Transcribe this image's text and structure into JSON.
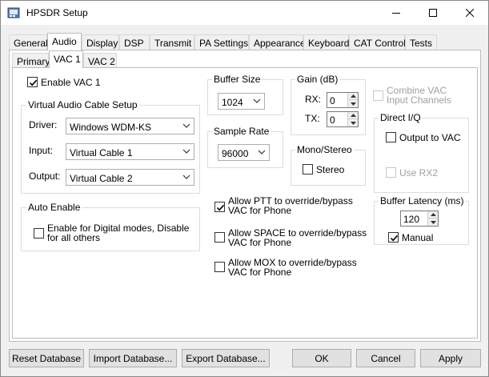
{
  "window": {
    "title": "HPSDR Setup"
  },
  "tabs": [
    {
      "label": "General"
    },
    {
      "label": "Audio"
    },
    {
      "label": "Display"
    },
    {
      "label": "DSP"
    },
    {
      "label": "Transmit"
    },
    {
      "label": "PA Settings"
    },
    {
      "label": "Appearance"
    },
    {
      "label": "Keyboard"
    },
    {
      "label": "CAT Control"
    },
    {
      "label": "Tests"
    }
  ],
  "subtabs": [
    {
      "label": "Primary"
    },
    {
      "label": "VAC 1"
    },
    {
      "label": "VAC 2"
    }
  ],
  "vac": {
    "enable_label": "Enable VAC 1",
    "enable_checked": true,
    "cable_setup": {
      "title": "Virtual Audio Cable Setup",
      "driver_label": "Driver:",
      "driver_value": "Windows WDM-KS",
      "input_label": "Input:",
      "input_value": "Virtual Cable 1",
      "output_label": "Output:",
      "output_value": "Virtual Cable 2"
    },
    "auto_enable": {
      "title": "Auto Enable",
      "option_line1": "Enable for Digital modes, Disable",
      "option_line2": "for all others",
      "checked": false
    },
    "buffer_size": {
      "title": "Buffer Size",
      "value": "1024"
    },
    "sample_rate": {
      "title": "Sample Rate",
      "value": "96000"
    },
    "gain": {
      "title": "Gain (dB)",
      "rx_label": "RX:",
      "rx_value": "0",
      "tx_label": "TX:",
      "tx_value": "0"
    },
    "mono_stereo": {
      "title": "Mono/Stereo",
      "stereo_label": "Stereo",
      "stereo_checked": false
    },
    "combine": {
      "line1": "Combine VAC",
      "line2": "Input Channels",
      "checked": false
    },
    "direct_iq": {
      "title": "Direct I/Q",
      "output_label": "Output to VAC",
      "output_checked": false,
      "rx2_label": "Use RX2",
      "rx2_checked": false
    },
    "buffer_latency": {
      "title": "Buffer Latency (ms)",
      "value": "120",
      "manual_label": "Manual",
      "manual_checked": true
    },
    "ptt": {
      "line1": "Allow PTT to override/bypass",
      "line2": "VAC for Phone",
      "checked": true
    },
    "space": {
      "line1": "Allow SPACE to override/bypass",
      "line2": "VAC for Phone",
      "checked": false
    },
    "mox": {
      "line1": "Allow MOX to override/bypass",
      "line2": "VAC for Phone",
      "checked": false
    }
  },
  "footer": {
    "reset_label": "Reset Database",
    "import_label": "Import Database...",
    "export_label": "Export Database...",
    "ok_label": "OK",
    "cancel_label": "Cancel",
    "apply_label": "Apply"
  }
}
